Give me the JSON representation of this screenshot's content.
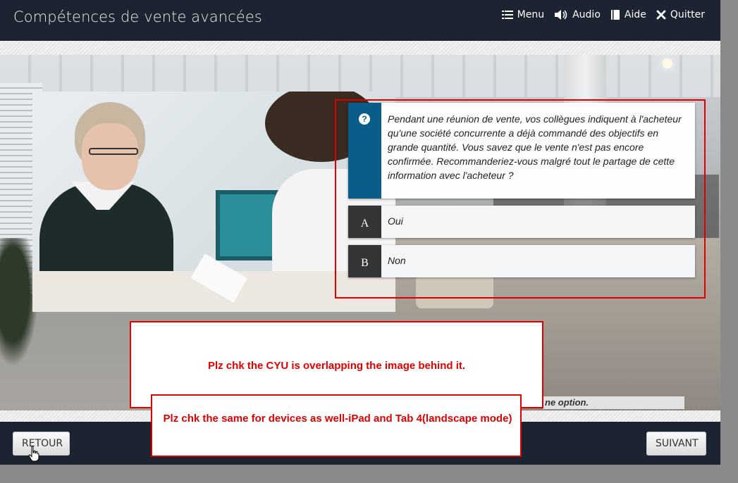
{
  "header": {
    "title": "Compétences de vente avancées",
    "nav": [
      {
        "label": "Menu",
        "icon": "list-icon"
      },
      {
        "label": "Audio",
        "icon": "speaker-icon"
      },
      {
        "label": "Aide",
        "icon": "book-icon"
      },
      {
        "label": "Quitter",
        "icon": "close-icon"
      }
    ]
  },
  "question": {
    "icon_glyph": "?",
    "text": "Pendant une réunion de vente, vos collègues indiquent à l'acheteur qu'une société concurrente a déjà commandé des objectifs en grande quantité. Vous savez que le vente n'est pas encore confirmée. Recommanderiez-vous malgré tout le partage de cette information avec l'acheteur ?",
    "options": [
      {
        "letter": "A",
        "label": "Oui"
      },
      {
        "letter": "B",
        "label": "Non"
      }
    ]
  },
  "instruction": "ne option.",
  "footer": {
    "back_label": "RETOUR",
    "next_label": "SUIVANT"
  },
  "review_comments": [
    "Plz chk the CYU is overlapping the image behind it.",
    "Plz chk the same for devices as well-iPad and Tab 4(landscape mode)"
  ],
  "colors": {
    "header_bg": "#1c2331",
    "question_accent": "#0a5c8a",
    "option_letter_bg": "#333536",
    "review_red": "#e00000"
  }
}
